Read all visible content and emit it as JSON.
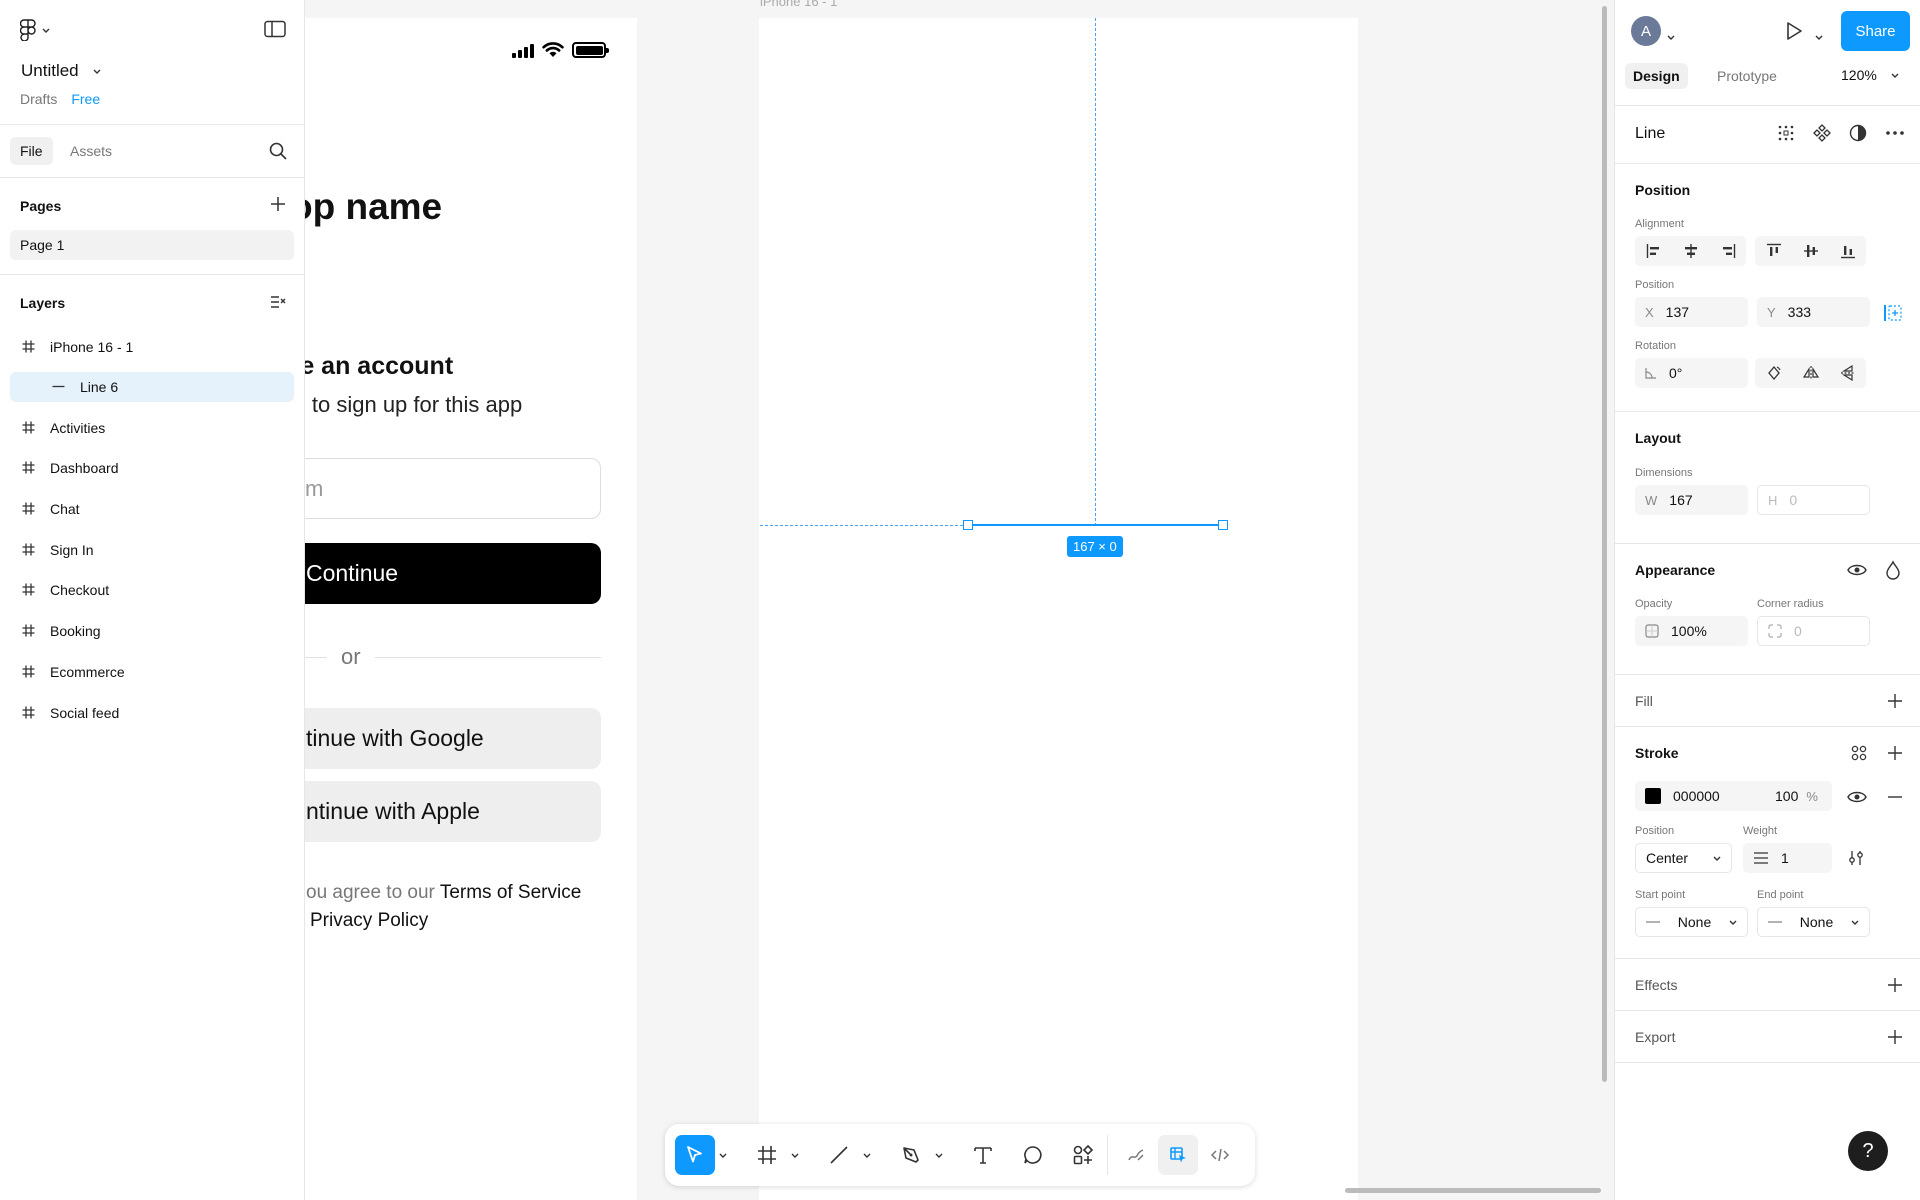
{
  "file": {
    "title": "Untitled",
    "location": "Drafts",
    "plan": "Free"
  },
  "left_tabs": {
    "file": "File",
    "assets": "Assets"
  },
  "pages": {
    "heading": "Pages",
    "items": [
      "Page 1"
    ]
  },
  "layers": {
    "heading": "Layers",
    "items": [
      {
        "name": "iPhone 16 - 1",
        "icon": "frame-icon"
      },
      {
        "name": "Line 6",
        "icon": "line-icon",
        "selected": true
      },
      {
        "name": "Activities",
        "icon": "frame-icon"
      },
      {
        "name": "Dashboard",
        "icon": "frame-icon"
      },
      {
        "name": "Chat",
        "icon": "frame-icon"
      },
      {
        "name": "Sign In",
        "icon": "frame-icon"
      },
      {
        "name": "Checkout",
        "icon": "frame-icon"
      },
      {
        "name": "Booking",
        "icon": "frame-icon"
      },
      {
        "name": "Ecommerce",
        "icon": "frame-icon"
      },
      {
        "name": "Social feed",
        "icon": "frame-icon"
      }
    ]
  },
  "canvas": {
    "frame_label": "iPhone 16 - 1",
    "app_name": "op name",
    "create_title": "te an account",
    "create_sub": "il to sign up for this app",
    "email_placeholder": "m",
    "continue_label": "Continue",
    "or_label": "or",
    "google_label": "tinue with Google",
    "apple_label": "ntinue with Apple",
    "terms_prefix": "ou agree to our ",
    "terms_link": "Terms of Service",
    "privacy_link": "Privacy Policy",
    "selection_size": "167 × 0"
  },
  "right": {
    "avatar_initial": "A",
    "share_label": "Share",
    "tabs": {
      "design": "Design",
      "prototype": "Prototype"
    },
    "zoom": "120%",
    "object_name": "Line",
    "position": {
      "heading": "Position",
      "alignment_label": "Alignment",
      "position_label": "Position",
      "x_prefix": "X",
      "x": "137",
      "y_prefix": "Y",
      "y": "333",
      "rotation_label": "Rotation",
      "rotation": "0°"
    },
    "layout": {
      "heading": "Layout",
      "dimensions_label": "Dimensions",
      "w_prefix": "W",
      "w": "167",
      "h_prefix": "H",
      "h": "0"
    },
    "appearance": {
      "heading": "Appearance",
      "opacity_label": "Opacity",
      "opacity": "100%",
      "radius_label": "Corner radius",
      "radius": "0"
    },
    "fill": {
      "heading": "Fill"
    },
    "stroke": {
      "heading": "Stroke",
      "color_hex": "000000",
      "color_value": "#000000",
      "opacity": "100",
      "percent": "%",
      "position_label": "Position",
      "position": "Center",
      "weight_label": "Weight",
      "weight": "1",
      "start_label": "Start point",
      "start": "None",
      "end_label": "End point",
      "end": "None"
    },
    "effects": {
      "heading": "Effects"
    },
    "export": {
      "heading": "Export"
    }
  },
  "help_label": "?",
  "colors": {
    "accent": "#0d99ff",
    "selected_layer_bg": "#e5f1fb"
  }
}
